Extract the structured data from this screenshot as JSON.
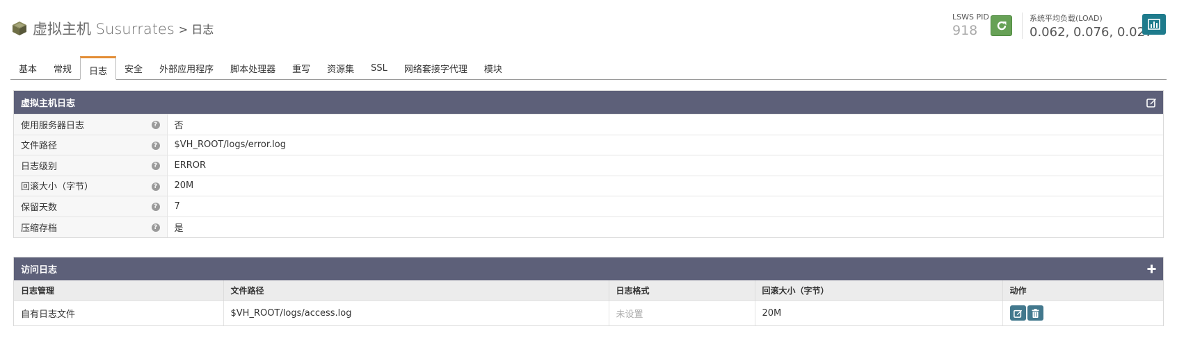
{
  "header": {
    "title": "虚拟主机 Susurrates",
    "breadcrumb_sep": ">",
    "breadcrumb_current": "日志"
  },
  "status": {
    "pid_label": "LSWS PID",
    "pid_value": "918",
    "load_label": "系统平均负载(LOAD)",
    "load_value": "0.062, 0.076, 0.027"
  },
  "tabs": [
    {
      "label": "基本"
    },
    {
      "label": "常规"
    },
    {
      "label": "日志",
      "active": true
    },
    {
      "label": "安全"
    },
    {
      "label": "外部应用程序"
    },
    {
      "label": "脚本处理器"
    },
    {
      "label": "重写"
    },
    {
      "label": "资源集"
    },
    {
      "label": "SSL"
    },
    {
      "label": "网络套接字代理"
    },
    {
      "label": "模块"
    }
  ],
  "vhost_log": {
    "title": "虚拟主机日志",
    "rows": [
      {
        "key": "使用服务器日志",
        "value": "否"
      },
      {
        "key": "文件路径",
        "value": "$VH_ROOT/logs/error.log"
      },
      {
        "key": "日志级别",
        "value": "ERROR"
      },
      {
        "key": "回滚大小（字节）",
        "value": "20M"
      },
      {
        "key": "保留天数",
        "value": "7"
      },
      {
        "key": "压缩存档",
        "value": "是"
      }
    ]
  },
  "access_log": {
    "title": "访问日志",
    "columns": [
      "日志管理",
      "文件路径",
      "日志格式",
      "回滚大小（字节）",
      "动作"
    ],
    "rows": [
      {
        "manage": "自有日志文件",
        "path": "$VH_ROOT/logs/access.log",
        "format": "未设置",
        "rollsize": "20M"
      }
    ]
  },
  "colors": {
    "panel_header": "#5d6079",
    "active_tab": "#e38d35",
    "reload_button": "#67a156",
    "stats_button": "#1e7b8c",
    "action_button": "#42788d"
  }
}
